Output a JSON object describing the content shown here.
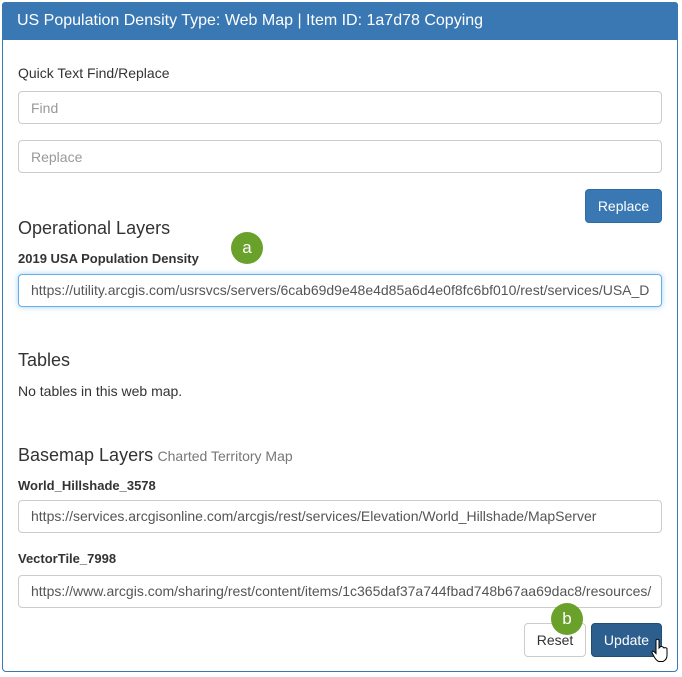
{
  "header": {
    "title": "US Population Density Type: Web Map | Item ID: 1a7d78 Copying"
  },
  "find_replace": {
    "label": "Quick Text Find/Replace",
    "find_placeholder": "Find",
    "replace_placeholder": "Replace",
    "replace_button": "Replace"
  },
  "operational": {
    "heading": "Operational Layers",
    "layer_name": "2019 USA Population Density",
    "layer_url": "https://utility.arcgis.com/usrsvcs/servers/6cab69d9e48e4d85a6d4e0f8fc6bf010/rest/services/USA_D"
  },
  "tables": {
    "heading": "Tables",
    "message": "No tables in this web map."
  },
  "basemap": {
    "heading": "Basemap Layers",
    "subtitle": "Charted Territory Map",
    "layers": [
      {
        "name": "World_Hillshade_3578",
        "url": "https://services.arcgisonline.com/arcgis/rest/services/Elevation/World_Hillshade/MapServer"
      },
      {
        "name": "VectorTile_7998",
        "url": "https://www.arcgis.com/sharing/rest/content/items/1c365daf37a744fbad748b67aa69dac8/resources/"
      }
    ]
  },
  "footer": {
    "reset": "Reset",
    "update": "Update"
  },
  "callouts": {
    "a": "a",
    "b": "b"
  }
}
